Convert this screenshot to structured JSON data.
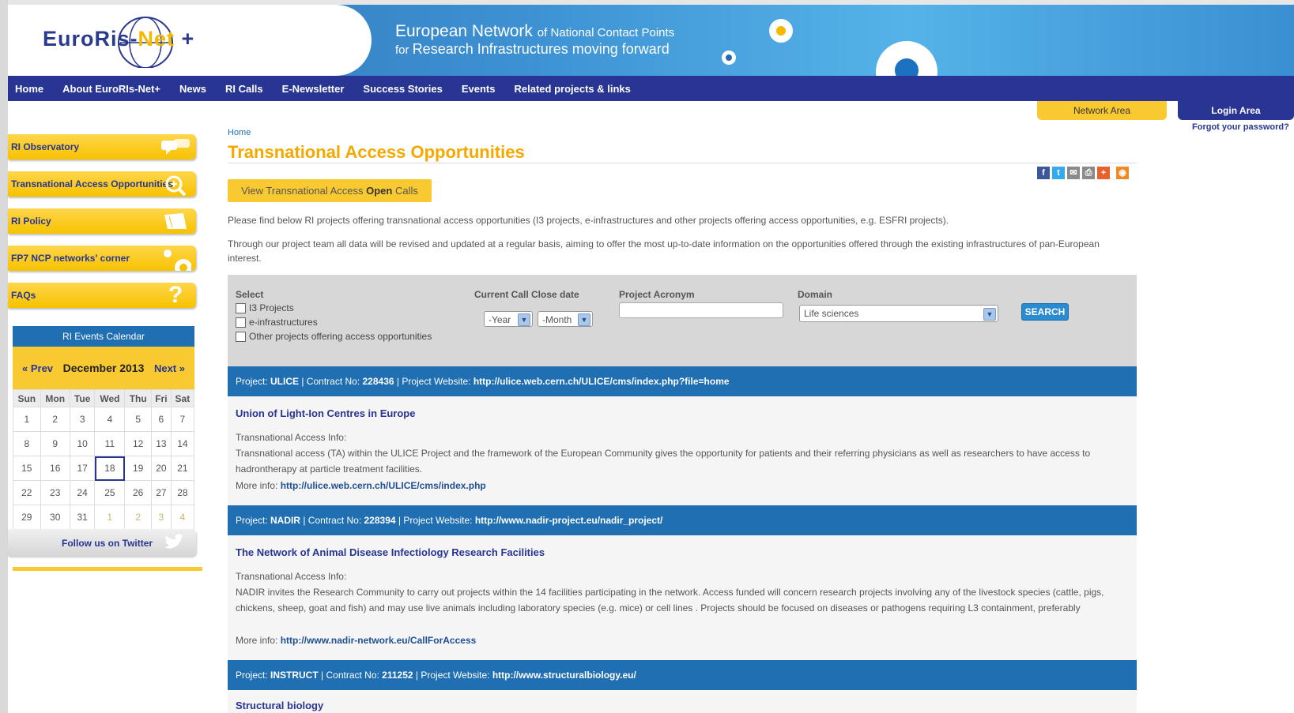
{
  "header": {
    "logo": "EuroRis-Net +",
    "logo_part1": "EuroRis-",
    "logo_part2": "Net",
    "logo_part3": " +",
    "tagline_l1_main": "European Network ",
    "tagline_l1_small": "of National Contact Points",
    "tagline_l2_small": "for ",
    "tagline_l2_main": "Research Infrastructures moving forward"
  },
  "nav": {
    "items": [
      "Home",
      "About EuroRIs-Net+",
      "News",
      "RI Calls",
      "E-Newsletter",
      "Success Stories",
      "Events",
      "Related projects & links"
    ]
  },
  "account": {
    "network_area": "Network Area",
    "login_area": "Login Area",
    "forgot": "Forgot your password?"
  },
  "sidebar": {
    "items": [
      {
        "label": "RI Observatory",
        "icon": "speech-bubbles-icon"
      },
      {
        "label": "Transnational Access Opportunities",
        "icon": "magnifier-plus-icon"
      },
      {
        "label": "RI Policy",
        "icon": "book-icon"
      },
      {
        "label": "FP7 NCP networks' corner",
        "icon": "circles-icon"
      },
      {
        "label": "FAQs",
        "icon": "question-icon"
      }
    ],
    "twitter": "Follow us on Twitter"
  },
  "calendar": {
    "title": "RI Events Calendar",
    "prev": "« Prev",
    "month": "December 2013",
    "next": "Next »",
    "days": [
      "Sun",
      "Mon",
      "Tue",
      "Wed",
      "Thu",
      "Fri",
      "Sat"
    ],
    "weeks": [
      [
        "1",
        "2",
        "3",
        "4",
        "5",
        "6",
        "7"
      ],
      [
        "8",
        "9",
        "10",
        "11",
        "12",
        "13",
        "14"
      ],
      [
        "15",
        "16",
        "17",
        "18",
        "19",
        "20",
        "21"
      ],
      [
        "22",
        "23",
        "24",
        "25",
        "26",
        "27",
        "28"
      ],
      [
        "29",
        "30",
        "31",
        "1",
        "2",
        "3",
        "4"
      ]
    ],
    "today": "18"
  },
  "main": {
    "breadcrumb": "Home",
    "title": "Transnational Access Opportunities",
    "open_calls_pre": "View Transnational Access ",
    "open_calls_bold": "Open",
    "open_calls_post": " Calls",
    "intro1": "Please find below RI projects offering transnational access opportunities (I3 projects, e-infrastructures and other projects offering access opportunities, e.g. ESFRI projects).",
    "intro2": "Through our project team all data will be revised and updated at a regular basis, aiming to offer the most up-to-date information on the opportunities offered through the existing infrastructures of pan-European interest."
  },
  "filter": {
    "select_label": "Select",
    "checkboxes": [
      "I3 Projects",
      "e-infrastructures",
      "Other projects offering access opportunities"
    ],
    "close_date_label": "Current Call Close date",
    "year": "-Year",
    "month": "-Month",
    "acronym_label": "Project Acronym",
    "acronym_value": "",
    "domain_label": "Domain",
    "domain_value": "Life sciences",
    "search": "SEARCH"
  },
  "projects": [
    {
      "acronym": "ULICE",
      "contract": "228436",
      "website": "http://ulice.web.cern.ch/ULICE/cms/index.php?file=home",
      "name": "Union of Light-Ion Centres in Europe",
      "info_label": "Transnational Access Info:",
      "info": "Transnational access (TA) within the ULICE Project and the framework of the European Community gives the opportunity for patients and their referring physicians as well as researchers to have access to hadrontherapy at particle treatment facilities.",
      "more": "http://ulice.web.cern.ch/ULICE/cms/index.php"
    },
    {
      "acronym": "NADIR",
      "contract": "228394",
      "website": "http://www.nadir-project.eu/nadir_project/",
      "name": "The Network of Animal Disease Infectiology Research Facilities",
      "info_label": "Transnational Access Info:",
      "info": "NADIR invites the Research Community to carry out projects within the 14 facilities participating in the network. Access funded will concern research projects involving any of the livestock species (cattle, pigs, chickens, sheep, goat and fish) and may use live animals including laboratory species (e.g. mice) or cell lines . Projects should be focused on diseases or pathogens requiring L3 containment, preferably",
      "more": "http://www.nadir-network.eu/CallForAccess"
    },
    {
      "acronym": "INSTRUCT",
      "contract": "211252",
      "website": "http://www.structuralbiology.eu/",
      "name": "Structural biology"
    }
  ],
  "labels": {
    "project": "Project: ",
    "contract": " | Contract No: ",
    "website": " | Project Website: ",
    "more": "More info: "
  }
}
